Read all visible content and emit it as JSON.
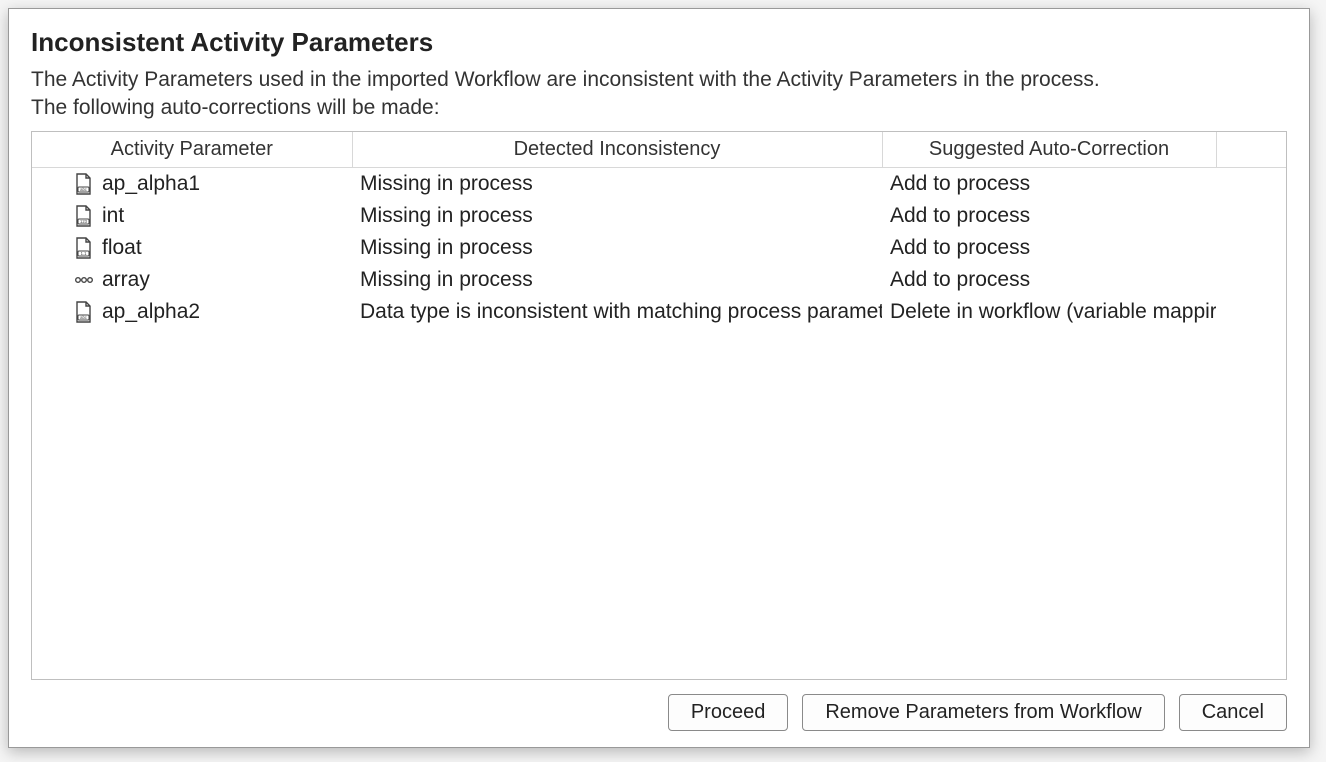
{
  "dialog": {
    "title": "Inconsistent Activity Parameters",
    "intro_line1": "The Activity Parameters used in the imported Workflow are inconsistent with the Activity Parameters in the process.",
    "intro_line2": "The following auto-corrections will be made:"
  },
  "table": {
    "columns": {
      "parameter": "Activity Parameter",
      "inconsistency": "Detected Inconsistency",
      "correction": "Suggested Auto-Correction"
    },
    "rows": [
      {
        "icon": "file-abc-icon",
        "name": "ap_alpha1",
        "inconsistency": "Missing in process",
        "correction": "Add to process"
      },
      {
        "icon": "file-123-icon",
        "name": "int",
        "inconsistency": "Missing in process",
        "correction": "Add to process"
      },
      {
        "icon": "file-float-icon",
        "name": "float",
        "inconsistency": "Missing in process",
        "correction": "Add to process"
      },
      {
        "icon": "array-icon",
        "name": "array",
        "inconsistency": "Missing in process",
        "correction": "Add to process"
      },
      {
        "icon": "file-abc-icon",
        "name": "ap_alpha2",
        "inconsistency": "Data type is inconsistent with matching process parameter",
        "correction": "Delete in workflow (variable mappir"
      }
    ]
  },
  "buttons": {
    "proceed": "Proceed",
    "remove": "Remove Parameters from Workflow",
    "cancel": "Cancel"
  }
}
